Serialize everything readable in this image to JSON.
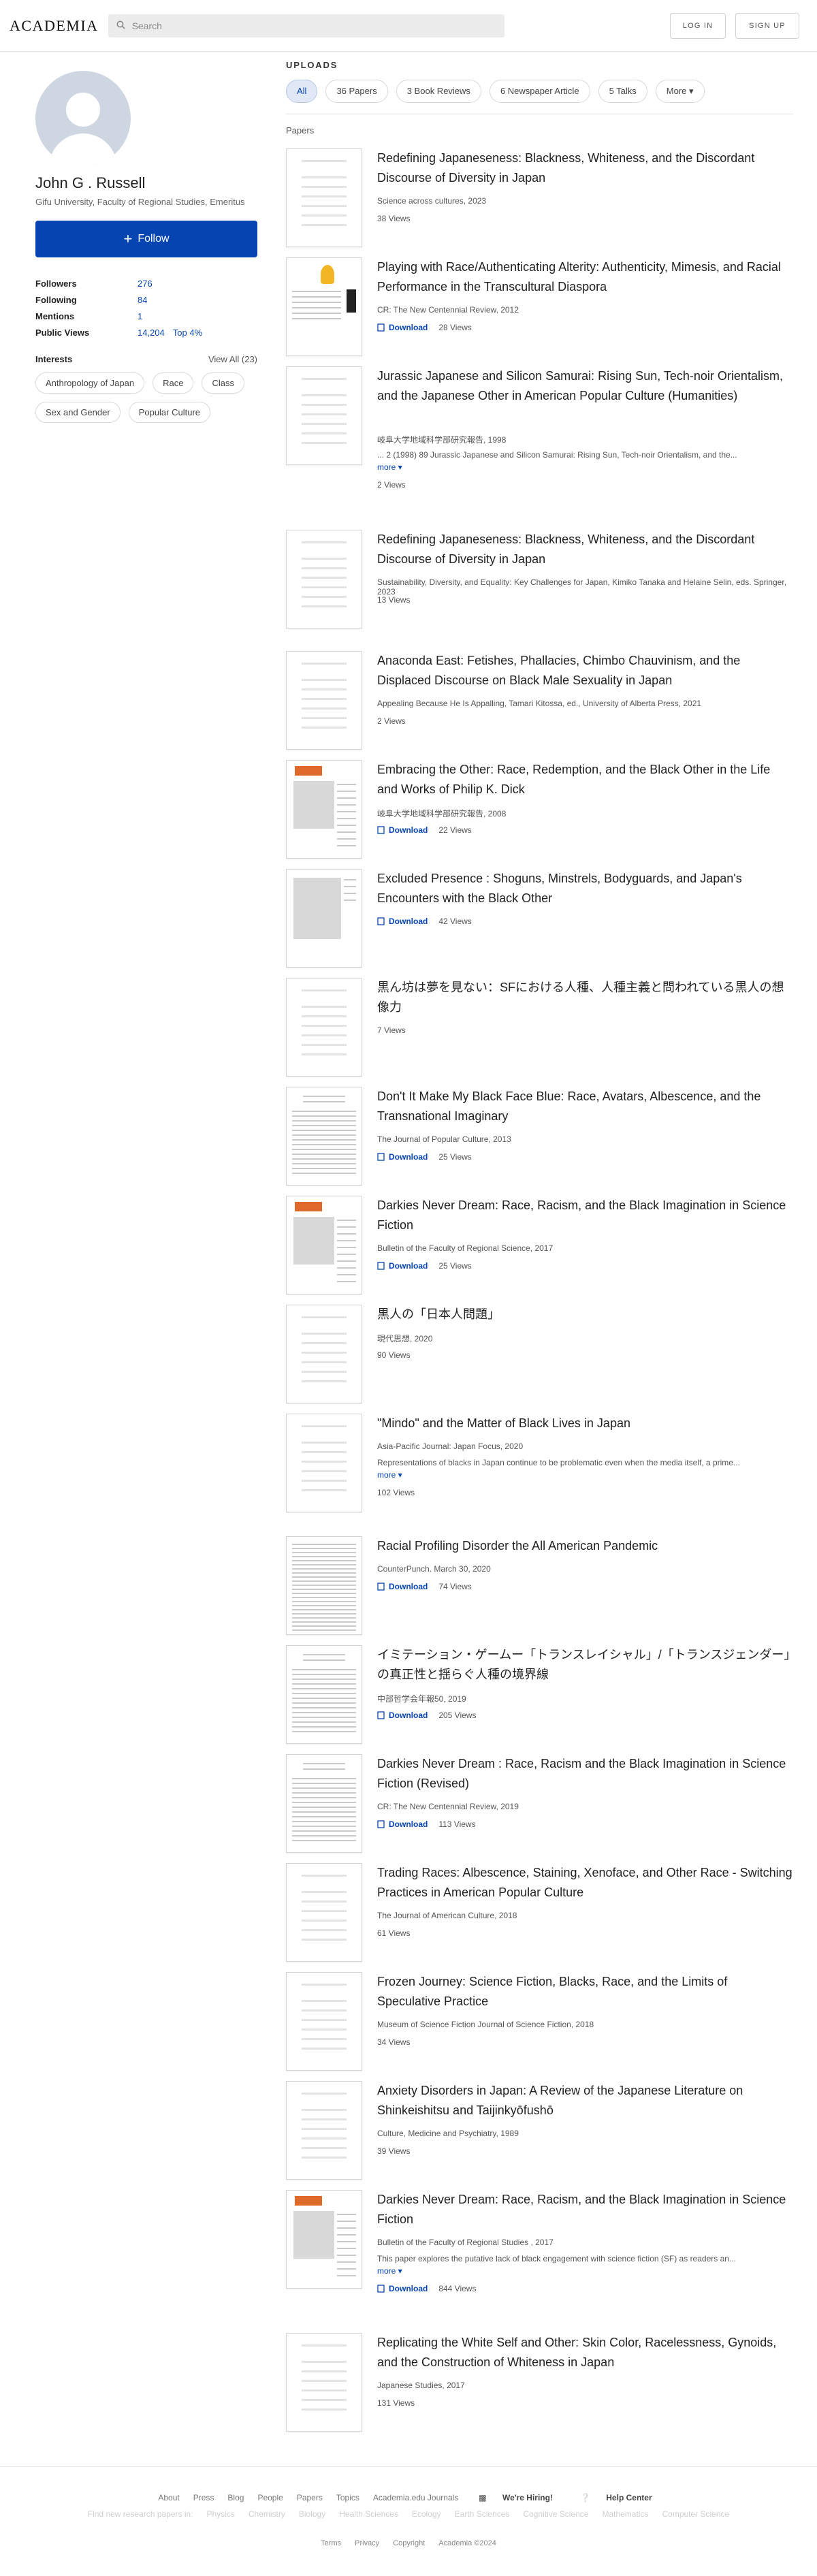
{
  "header": {
    "logo": "ACADEMIA",
    "search_placeholder": "Search",
    "login": "LOG IN",
    "signup": "SIGN UP"
  },
  "profile": {
    "name": "John G . Russell",
    "affiliation": "Gifu University, Faculty of Regional Studies, Emeritus",
    "follow_label": "Follow",
    "stats": [
      {
        "label": "Followers",
        "value": "276",
        "extra": ""
      },
      {
        "label": "Following",
        "value": "84",
        "extra": ""
      },
      {
        "label": "Mentions",
        "value": "1",
        "extra": ""
      },
      {
        "label": "Public Views",
        "value": "14,204",
        "extra": "Top 4%"
      }
    ],
    "interests_title": "Interests",
    "view_all": "View All (23)",
    "interests": [
      "Anthropology of Japan",
      "Race",
      "Class",
      "Sex and Gender",
      "Popular Culture"
    ]
  },
  "uploads": {
    "title": "UPLOADS",
    "tabs": [
      "All",
      "36 Papers",
      "3 Book Reviews",
      "6 Newspaper Article",
      "5 Talks",
      "More"
    ],
    "section": "Papers"
  },
  "papers": [
    {
      "title": "Redefining Japaneseness: Blackness, Whiteness, and the Discordant Discourse of Diversity in Japan",
      "meta": "Science across cultures, 2023",
      "views": "38 Views"
    },
    {
      "title": "Playing with Race/Authenticating Alterity: Authenticity, Mimesis, and Racial Performance in the Transcultural Diaspora",
      "meta": "CR: The New Centennial Review, 2012",
      "download": "Download",
      "views": "28 Views"
    },
    {
      "title": "Jurassic Japanese and Silicon Samurai: Rising Sun, Tech-noir Orientalism, and the Japanese Other in American Popular Culture (Humanities)",
      "meta": "岐阜大学地域科学部研究報告, 1998",
      "excerpt": "... 2 (1998) 89 Jurassic Japanese and Silicon Samurai: Rising Sun, Tech-noir Orientalism, and the...",
      "more": "more",
      "views": "2 Views"
    },
    {
      "title": "Redefining Japaneseness: Blackness, Whiteness, and the Discordant Discourse of Diversity in Japan",
      "meta": "Sustainability, Diversity, and Equality: Key Challenges for Japan, Kimiko Tanaka and Helaine Selin, eds. Springer, 2023",
      "views": "13 Views"
    },
    {
      "title": "Anaconda East: Fetishes, Phallacies, Chimbo Chauvinism, and the Displaced Discourse on Black Male Sexuality in Japan",
      "meta": "Appealing Because He Is Appalling, Tamari Kitossa, ed., University of Alberta Press, 2021",
      "views": "2 Views"
    },
    {
      "title": "Embracing the Other: Race, Redemption, and the Black Other in the Life and Works of Philip K. Dick",
      "meta": "岐阜大学地域科学部研究報告, 2008",
      "download": "Download",
      "views": "22 Views"
    },
    {
      "title": "Excluded Presence : Shoguns, Minstrels, Bodyguards, and Japan's Encounters with the Black Other",
      "download": "Download",
      "views": "42 Views"
    },
    {
      "title": "黒ん坊は夢を見ない：SFにおける人種、人種主義と問われている黒人の想像力",
      "views": "7 Views"
    },
    {
      "title": "Don't It Make My Black Face Blue: Race, Avatars, Albescence, and the Transnational Imaginary",
      "meta": "The Journal of Popular Culture, 2013",
      "download": "Download",
      "views": "25 Views"
    },
    {
      "title": "Darkies Never Dream: Race, Racism, and the Black Imagination in Science Fiction",
      "meta": "Bulletin of the Faculty of Regional Science, 2017",
      "download": "Download",
      "views": "25 Views"
    },
    {
      "title": "黒人の「日本人問題」",
      "meta": "現代思想, 2020",
      "views": "90 Views"
    },
    {
      "title": "\"Mindo\" and the Matter of Black Lives in Japan",
      "meta": "Asia-Pacific Journal: Japan Focus, 2020",
      "excerpt": "Representations of blacks in Japan continue to be problematic even when the media itself, a prime...",
      "more": "more",
      "views": "102 Views"
    },
    {
      "title": "Racial Profiling Disorder the All American Pandemic",
      "meta": "CounterPunch. March 30, 2020",
      "download": "Download",
      "views": "74 Views"
    },
    {
      "title": "イミテーション・ゲームー「トランスレイシャル」/「トランスジェンダー」の真正性と揺らぐ人種の境界線",
      "meta": "中部哲学会年報50, 2019",
      "download": "Download",
      "views": "205 Views"
    },
    {
      "title": "Darkies Never Dream : Race, Racism and the Black Imagination in Science Fiction (Revised)",
      "meta": "CR: The New Centennial Review, 2019",
      "download": "Download",
      "views": "113 Views"
    },
    {
      "title": "Trading Races: Albescence, Staining, Xenoface, and Other Race - Switching Practices in American Popular Culture",
      "meta": "The Journal of American Culture, 2018",
      "views": "61 Views"
    },
    {
      "title": "Frozen Journey: Science Fiction, Blacks, Race, and the Limits of Speculative Practice",
      "meta": "Museum of Science Fiction Journal of Science Fiction, 2018",
      "views": "34 Views"
    },
    {
      "title": "Anxiety Disorders in Japan: A Review of the Japanese Literature on Shinkeishitsu and Taijinkyōfushō",
      "meta": "Culture, Medicine and Psychiatry, 1989",
      "views": "39 Views"
    },
    {
      "title": "Darkies Never Dream: Race, Racism, and the Black Imagination in Science Fiction",
      "meta": "Bulletin of the Faculty of Regional Studies , 2017",
      "excerpt": "This paper explores the putative lack of black engagement with science fiction (SF) as readers an...",
      "more": "more",
      "download": "Download",
      "views": "844 Views"
    },
    {
      "title": "Replicating the White Self and Other: Skin Color, Racelessness, Gynoids, and the Construction of Whiteness in Japan",
      "meta": "Japanese Studies, 2017",
      "views": "131 Views"
    }
  ],
  "footer": {
    "links": [
      "About",
      "Press",
      "Blog",
      "People",
      "Papers",
      "Topics",
      "Academia.edu Journals",
      "We're Hiring!",
      "Help Center"
    ],
    "research_links": [
      "Find new research papers in:",
      "Physics",
      "Chemistry",
      "Biology",
      "Health Sciences",
      "Ecology",
      "Earth Sciences",
      "Cognitive Science",
      "Mathematics",
      "Computer Science"
    ],
    "legal": [
      "Terms",
      "Privacy",
      "Copyright",
      "Academia ©2024"
    ]
  }
}
